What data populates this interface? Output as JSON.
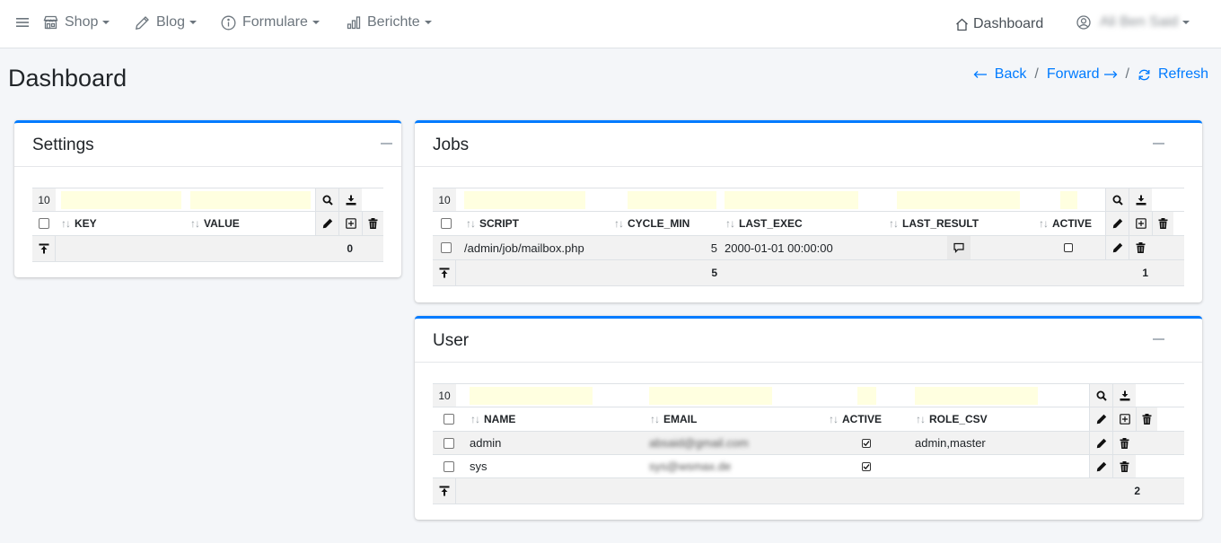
{
  "nav": {
    "menu": [
      {
        "label": "Shop"
      },
      {
        "label": "Blog"
      },
      {
        "label": "Formulare"
      },
      {
        "label": "Berichte"
      }
    ],
    "dashboard_label": "Dashboard",
    "user_name": "Ali Ben Said"
  },
  "page": {
    "title": "Dashboard",
    "back_label": "Back",
    "forward_label": "Forward",
    "refresh_label": "Refresh",
    "separator": "/"
  },
  "settings": {
    "title": "Settings",
    "page_size": "10",
    "columns": [
      "KEY",
      "VALUE"
    ],
    "footer_count": "0"
  },
  "jobs": {
    "title": "Jobs",
    "page_size": "10",
    "columns": [
      "SCRIPT",
      "CYCLE_MIN",
      "LAST_EXEC",
      "LAST_RESULT",
      "ACTIVE"
    ],
    "rows": [
      {
        "script": "/admin/job/mailbox.php",
        "cycle_min": "5",
        "last_exec": "2000-01-01 00:00:00",
        "last_result_icon": "comment-icon",
        "active": false
      }
    ],
    "footer_cycle_sum": "5",
    "footer_active_sum": "1"
  },
  "user": {
    "title": "User",
    "page_size": "10",
    "columns": [
      "NAME",
      "EMAIL",
      "ACTIVE",
      "ROLE_CSV"
    ],
    "rows": [
      {
        "name": "admin",
        "email": "absaid@gmail.com",
        "active": true,
        "role_csv": "admin,master"
      },
      {
        "name": "sys",
        "email": "sys@wsmax.de",
        "active": true,
        "role_csv": ""
      }
    ],
    "footer_active_sum": "2"
  },
  "colors": {
    "accent": "#007bff",
    "filter_bg": "#ffffe0",
    "stripe": "#f2f2f2"
  }
}
